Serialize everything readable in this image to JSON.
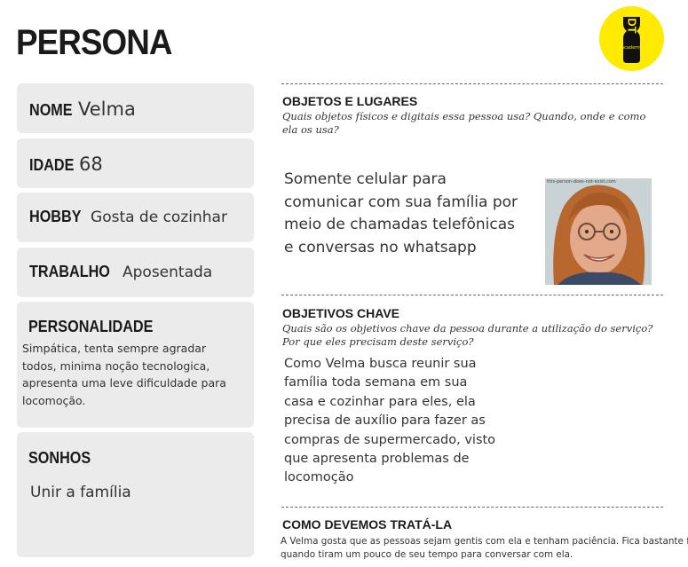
{
  "title": "PERSONA",
  "logo": {
    "text": "DT",
    "sub": "academy"
  },
  "fields": {
    "nome": {
      "label": "NOME",
      "value": "Velma"
    },
    "idade": {
      "label": "IDADE",
      "value": "68"
    },
    "hobby": {
      "label": "HOBBY",
      "value": "Gosta de cozinhar"
    },
    "trabalho": {
      "label": "TRABALHO",
      "value": "Aposentada"
    },
    "personalidade": {
      "label": "PERSONALIDADE",
      "lines": [
        "Simpática, tenta sempre agradar",
        "todos, minima noção tecnologica,",
        "apresenta uma leve dificuldade para",
        "locomoção."
      ]
    },
    "sonhos": {
      "label": "SONHOS",
      "value": "Unir a família"
    }
  },
  "sections": {
    "objetos": {
      "title": "OBJETOS E LUGARES",
      "subtitle_lines": [
        "Quais objetos físicos e digitais essa pessoa usa? Quando, onde e como",
        "ela os usa?"
      ],
      "body_lines": [
        "Somente celular para",
        "comunicar com sua família por",
        "meio de chamadas telefônicas",
        "e conversas no whatsapp"
      ],
      "photo_caption": "this-person-does-not-exist.com"
    },
    "objetivos": {
      "title": "OBJETIVOS CHAVE",
      "subtitle_lines": [
        "Quais são os objetivos chave da pessoa durante a utilização do serviço?",
        "Por que eles precisam deste serviço?"
      ],
      "body_lines": [
        "Como Velma busca reunir sua",
        "família toda semana em sua",
        "casa e cozinhar para eles, ela",
        "precisa de auxílio para fazer as",
        "compras de supermercado, visto",
        "que apresenta problemas de",
        "locomoção"
      ]
    },
    "tratar": {
      "title": "COMO DEVEMOS TRATÁ-LA",
      "body_lines": [
        "A Velma gosta que as pessoas sejam gentis com ela e tenham paciência. Fica bastante feliz",
        "quando tiram um pouco de seu tempo para conversar com ela."
      ]
    }
  }
}
